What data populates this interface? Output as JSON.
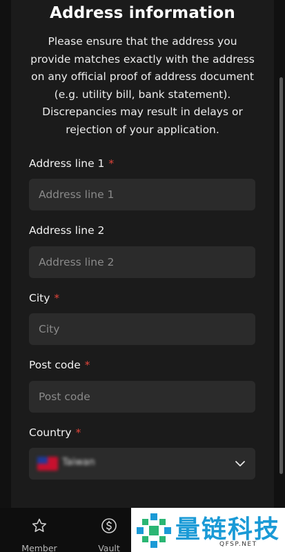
{
  "header": {
    "title": "Address information",
    "description": "Please ensure that the address you provide matches exactly with the address on any official proof of address document (e.g. utility bill, bank statement). Discrepancies may result in delays or rejection of your application."
  },
  "form": {
    "address_line_1": {
      "label": "Address line 1",
      "required_mark": "*",
      "placeholder": "Address line 1",
      "value": ""
    },
    "address_line_2": {
      "label": "Address line 2",
      "placeholder": "Address line 2",
      "value": ""
    },
    "city": {
      "label": "City",
      "required_mark": "*",
      "placeholder": "City",
      "value": ""
    },
    "post_code": {
      "label": "Post code",
      "required_mark": "*",
      "placeholder": "Post code",
      "value": ""
    },
    "country": {
      "label": "Country",
      "required_mark": "*",
      "selected": "Taiwan",
      "flag_icon": "taiwan-flag-icon"
    }
  },
  "tabbar": {
    "items": [
      {
        "label": "Member",
        "icon": "star-icon"
      },
      {
        "label": "Vault",
        "icon": "dollar-circle-icon"
      }
    ]
  },
  "watermark": {
    "text": "量链科技",
    "subtext": "QFSP.NET"
  },
  "colors": {
    "background": "#1b1b1b",
    "field": "#2b2b2b",
    "required": "#e0443a",
    "watermark": "#1a9ad6"
  }
}
